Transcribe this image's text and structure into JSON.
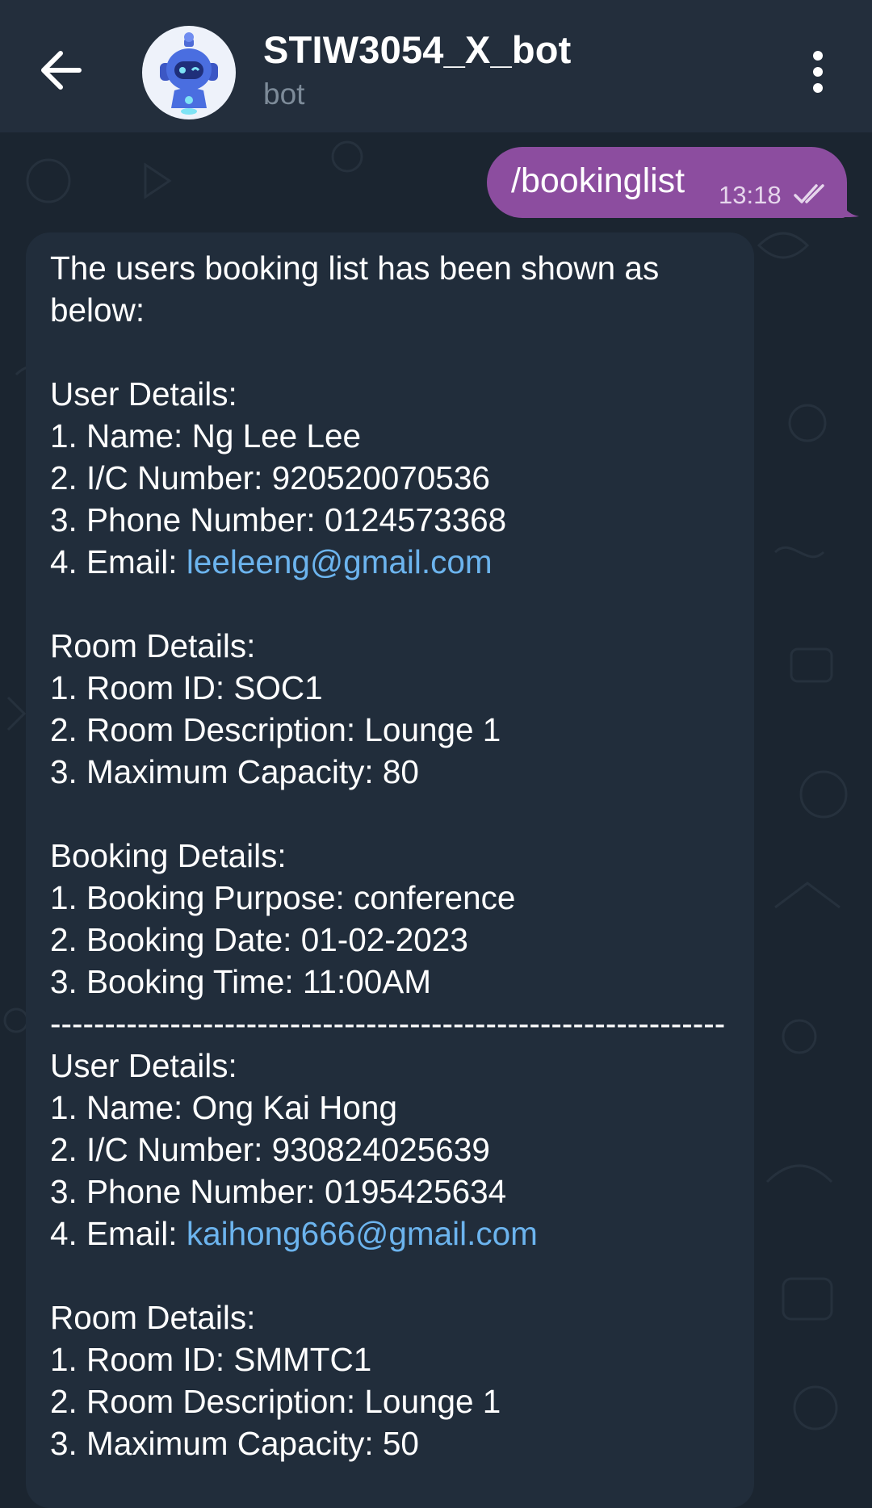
{
  "header": {
    "title": "STIW3054_X_bot",
    "subtitle": "bot",
    "back_icon": "arrow-left-icon",
    "menu_icon": "more-vertical-icon",
    "avatar_icon": "robot-avatar-icon"
  },
  "sent_message": {
    "text": "/bookinglist",
    "time": "13:18",
    "status_icon": "double-check-icon"
  },
  "received_message": {
    "intro_line1": "The users booking list has been shown as",
    "intro_line2": "below:",
    "booking1": {
      "user_heading": "User Details:",
      "name": "1. Name: Ng Lee Lee",
      "ic": "2. I/C Number: 920520070536",
      "phone": "3. Phone Number: 0124573368",
      "email_label": "4. Email: ",
      "email": "leeleeng@gmail.com",
      "room_heading": "Room Details:",
      "room_id": "1. Room ID: SOC1",
      "room_desc": "2. Room Description: Lounge 1",
      "capacity": "3. Maximum Capacity: 80",
      "booking_heading": "Booking Details:",
      "purpose": "1. Booking Purpose: conference",
      "date": "2. Booking Date: 01-02-2023",
      "time": "3. Booking Time: 11:00AM"
    },
    "separator": "--------------------------------------------------------------------------",
    "booking2": {
      "user_heading": "User Details:",
      "name": "1. Name: Ong Kai Hong",
      "ic": "2. I/C Number: 930824025639",
      "phone": "3. Phone Number: 0195425634",
      "email_label": "4. Email: ",
      "email": "kaihong666@gmail.com",
      "room_heading": "Room Details:",
      "room_id": "1. Room ID: SMMTC1",
      "room_desc": "2. Room Description: Lounge 1",
      "capacity": "3. Maximum Capacity: 50"
    }
  },
  "colors": {
    "background": "#1b2530",
    "header": "#232e3c",
    "sent_bubble": "#8c4d9f",
    "received_bubble": "#212d3b",
    "link": "#6cb4ee"
  }
}
